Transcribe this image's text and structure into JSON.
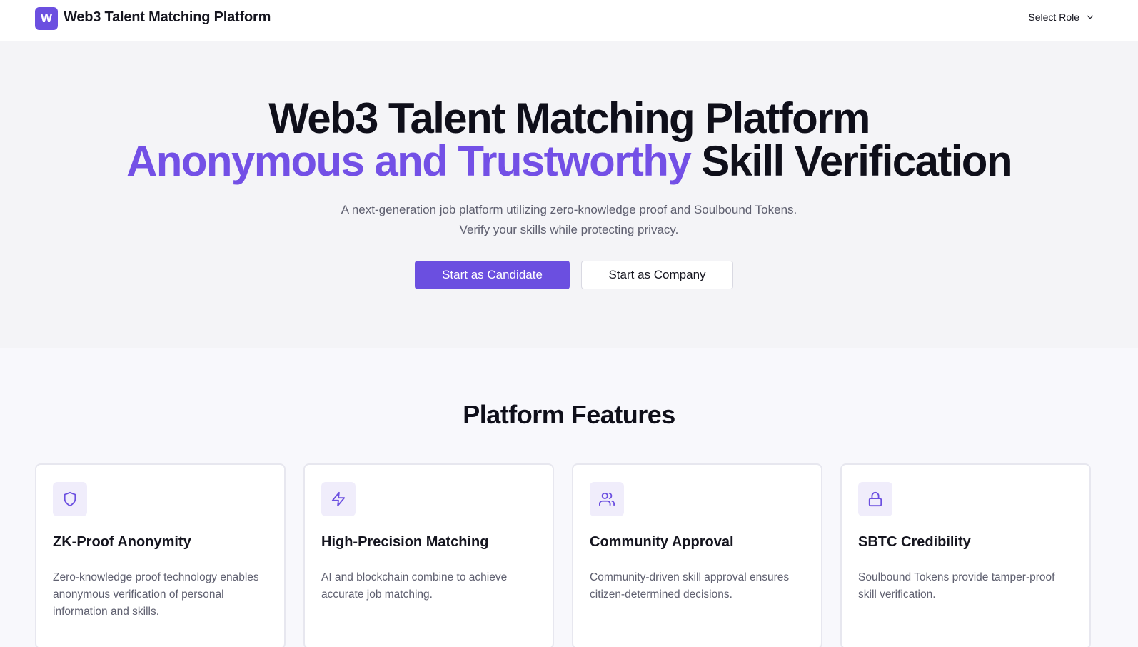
{
  "header": {
    "logo_letter": "W",
    "brand": "Web3 Talent Matching Platform",
    "role_select_label": "Select Role"
  },
  "hero": {
    "title_line1": "Web3 Talent Matching Platform",
    "title_line2_accent": "Anonymous and Trustworthy",
    "title_line2_rest": " Skill Verification",
    "subtitle_line1": "A next-generation job platform utilizing zero-knowledge proof and Soulbound Tokens.",
    "subtitle_line2": "Verify your skills while protecting privacy.",
    "primary_button": "Start as Candidate",
    "secondary_button": "Start as Company"
  },
  "features": {
    "title": "Platform Features",
    "cards": [
      {
        "icon": "shield-icon",
        "title": "ZK-Proof Anonymity",
        "description": "Zero-knowledge proof technology enables anonymous verification of personal information and skills."
      },
      {
        "icon": "lightning-icon",
        "title": "High-Precision Matching",
        "description": "AI and blockchain combine to achieve accurate job matching."
      },
      {
        "icon": "users-icon",
        "title": "Community Approval",
        "description": "Community-driven skill approval ensures citizen-determined decisions."
      },
      {
        "icon": "lock-icon",
        "title": "SBTC Credibility",
        "description": "Soulbound Tokens provide tamper-proof skill verification."
      }
    ]
  },
  "colors": {
    "accent": "#7350e6",
    "primary_button": "#6b4fe0",
    "icon_bg": "#f0edfb"
  }
}
